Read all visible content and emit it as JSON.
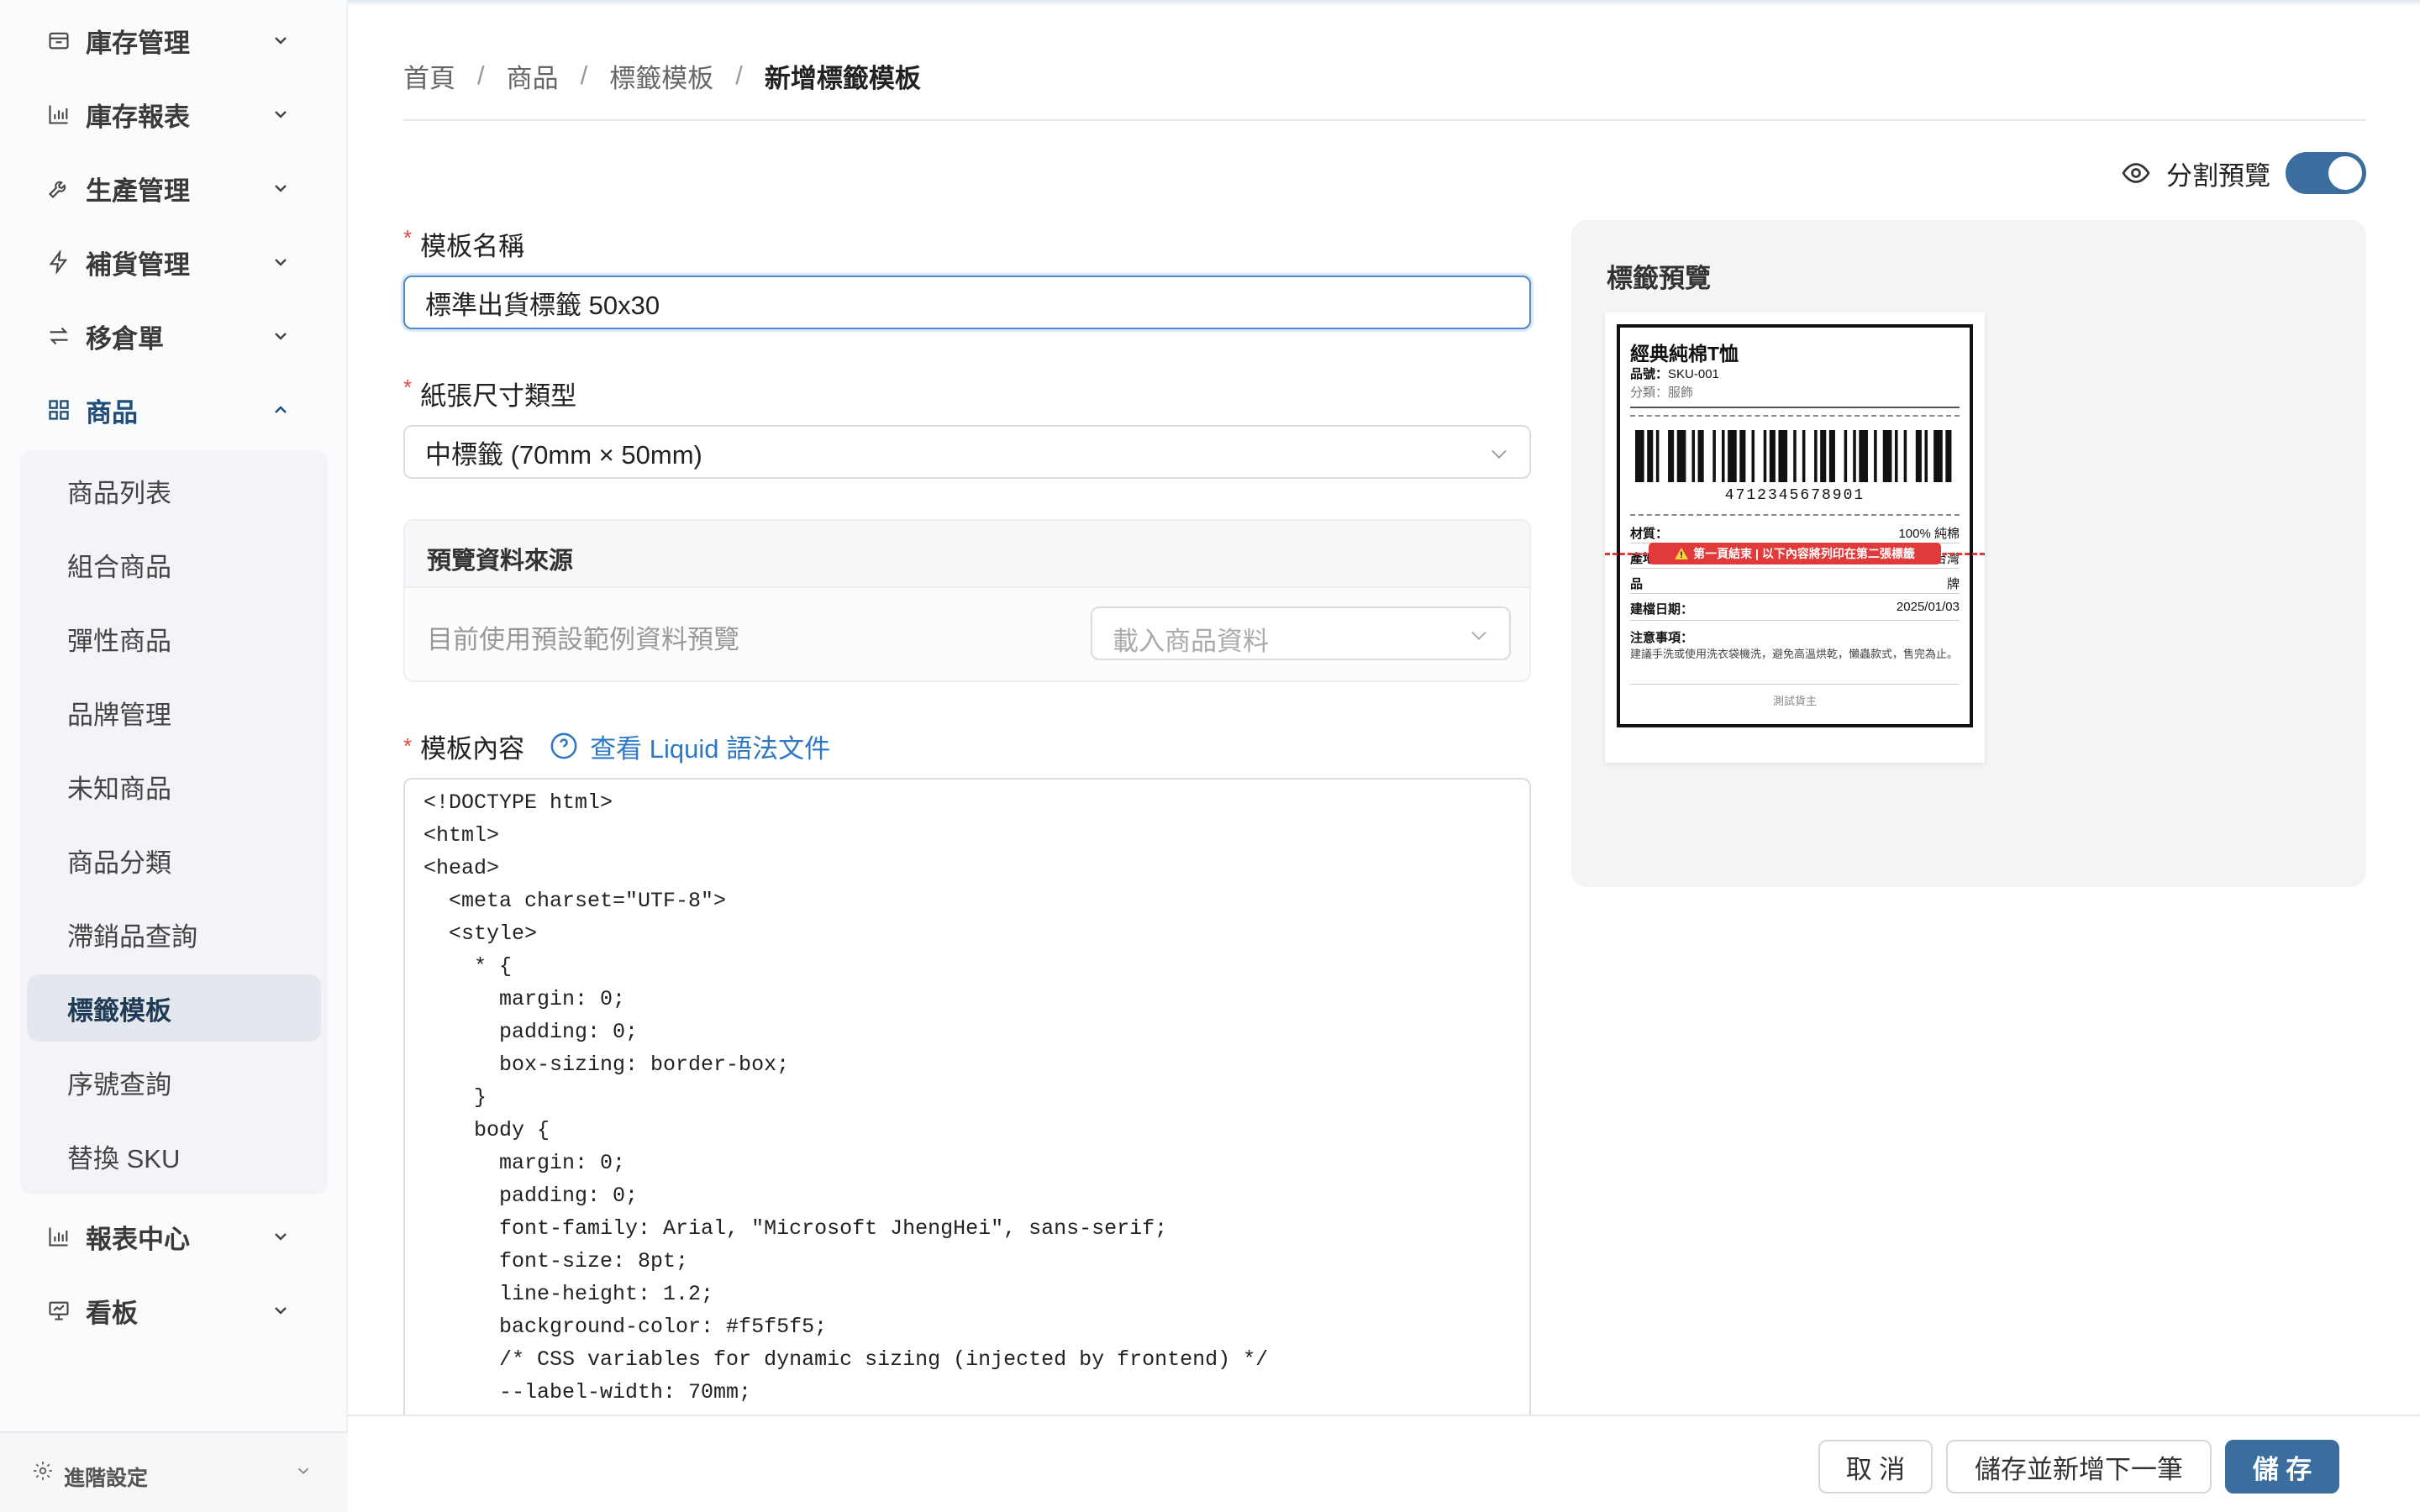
{
  "sidebar": {
    "items": [
      {
        "label": "庫存管理",
        "icon": "archive-icon"
      },
      {
        "label": "庫存報表",
        "icon": "bar-chart-icon"
      },
      {
        "label": "生產管理",
        "icon": "wrench-icon"
      },
      {
        "label": "補貨管理",
        "icon": "lightning-icon"
      },
      {
        "label": "移倉單",
        "icon": "transfer-icon"
      },
      {
        "label": "商品",
        "icon": "grid-icon"
      },
      {
        "label": "報表中心",
        "icon": "bar-chart-icon"
      },
      {
        "label": "看板",
        "icon": "presentation-icon"
      }
    ],
    "submenu": [
      "商品列表",
      "組合商品",
      "彈性商品",
      "品牌管理",
      "未知商品",
      "商品分類",
      "滯銷品查詢",
      "標籤模板",
      "序號查詢",
      "替換 SKU"
    ],
    "footer_label": "進階設定"
  },
  "breadcrumb": [
    "首頁",
    "商品",
    "標籤模板",
    "新增標籤模板"
  ],
  "split_preview": {
    "label": "分割預覽",
    "enabled": true
  },
  "form": {
    "name_label": "模板名稱",
    "name_value": "標準出貨標籤 50x30",
    "paper_label": "紙張尺寸類型",
    "paper_value": "中標籤 (70mm × 50mm)",
    "source_title": "預覽資料來源",
    "source_desc": "目前使用預設範例資料預覽",
    "source_placeholder": "載入商品資料",
    "content_label": "模板內容",
    "doc_link": "查看 Liquid 語法文件",
    "code": "<!DOCTYPE html>\n<html>\n<head>\n  <meta charset=\"UTF-8\">\n  <style>\n    * {\n      margin: 0;\n      padding: 0;\n      box-sizing: border-box;\n    }\n    body {\n      margin: 0;\n      padding: 0;\n      font-family: Arial, \"Microsoft JhengHei\", sans-serif;\n      font-size: 8pt;\n      line-height: 1.2;\n      background-color: #f5f5f5;\n      /* CSS variables for dynamic sizing (injected by frontend) */\n      --label-width: 70mm;"
  },
  "preview": {
    "title": "標籤預覽",
    "product_name": "經典純棉T恤",
    "sku_label": "品號：",
    "sku": "SKU-001",
    "category": "分類：服飾",
    "barcode": "4712345678901",
    "material_label": "材質：",
    "material": "100% 純棉",
    "origin_label": "產地：",
    "origin": "台灣",
    "hidden_left": "品",
    "hidden_right": "牌",
    "date_label": "建檔日期：",
    "date": "2025/01/03",
    "notes_label": "注意事項：",
    "notes": "建議手洗或使用洗衣袋機洗，避免高溫烘乾，懶蟲款式，售完為止。",
    "footer": "測試貨主",
    "page_break": "第一頁結束 | 以下內容將列印在第二張標籤"
  },
  "actions": {
    "cancel": "取 消",
    "save_next": "儲存並新增下一筆",
    "save": "儲 存"
  },
  "colors": {
    "primary": "#3b6e9f",
    "link": "#2f78c4",
    "required": "#e04a4a",
    "page_break": "#e03a3a"
  }
}
